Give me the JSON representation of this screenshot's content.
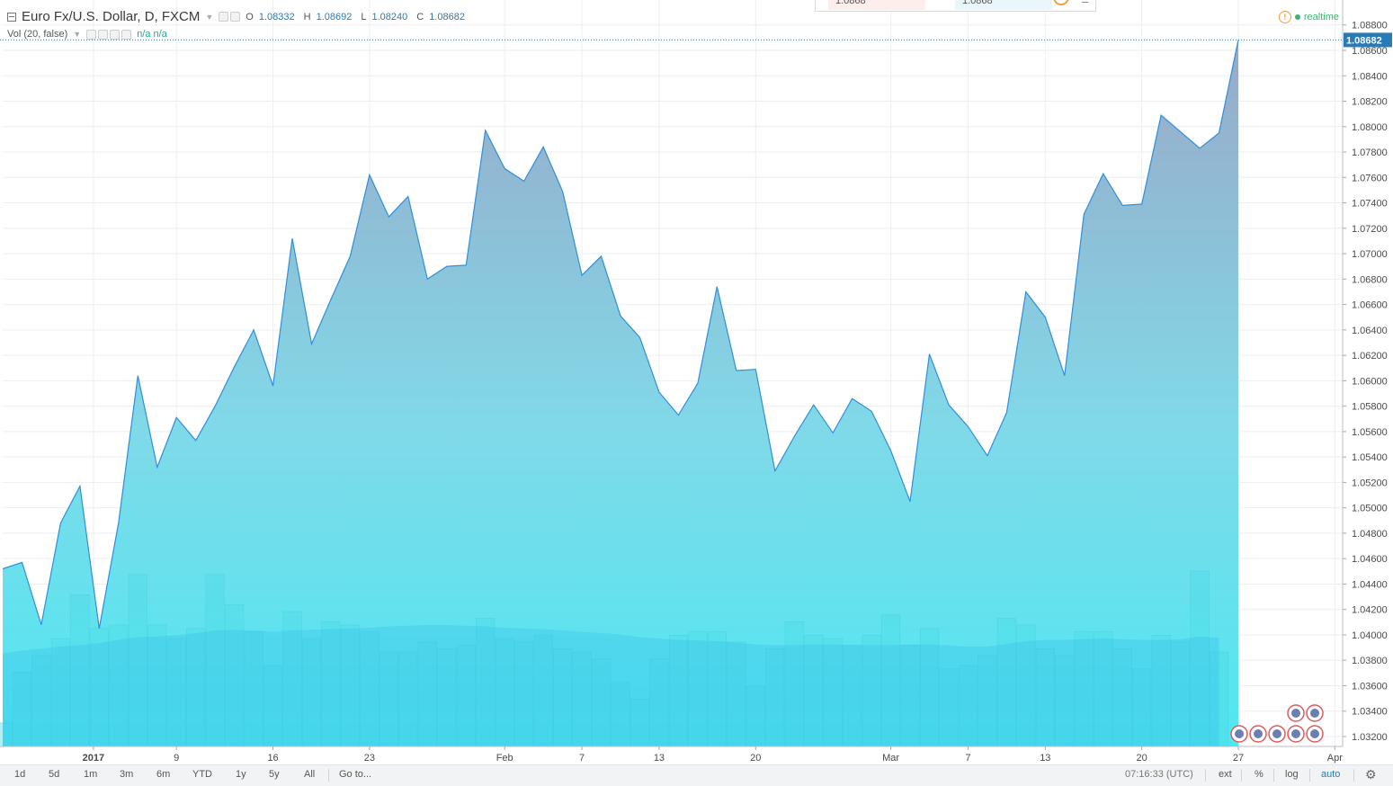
{
  "legend": {
    "symbol": "Euro Fx/U.S. Dollar, D, FXCM",
    "open_key": "O",
    "open": "1.08332",
    "high_key": "H",
    "high": "1.08692",
    "low_key": "L",
    "low": "1.08240",
    "close_key": "C",
    "close": "1.08682",
    "volume_label": "Vol (20, false)",
    "volume_values": "n/a n/a"
  },
  "status": {
    "realtime_label": "realtime"
  },
  "order_panel": {
    "sell_price": "1.0868",
    "buy_price": "1.0868"
  },
  "last_price_label": "1.08682",
  "timeframes": [
    "1d",
    "5d",
    "1m",
    "3m",
    "6m",
    "YTD",
    "1y",
    "5y",
    "All"
  ],
  "goto_label": "Go to...",
  "clock": "07:16:33 (UTC)",
  "scale_options": [
    "ext",
    "%",
    "log",
    "auto"
  ],
  "colors": {
    "line": "#2f8fd8",
    "area_top": "#9aa8c8",
    "area_bottom": "#4ee5f0",
    "volume": "#4ed9e3",
    "volume_ma": "#2fb7e8",
    "accent": "#2a7ab6"
  },
  "chart_data": {
    "type": "area",
    "series": [
      {
        "values": [
          1.0452,
          1.0457,
          1.0408,
          1.0488,
          1.0517,
          1.0405,
          1.0488,
          1.0604,
          1.0532,
          1.0571,
          1.0553,
          1.058,
          1.0611,
          1.064,
          1.0596,
          1.0712,
          1.0629,
          1.0664,
          1.0698,
          1.0762,
          1.0729,
          1.0745,
          1.068,
          1.069,
          1.0691,
          1.0797,
          1.0767,
          1.0757,
          1.0784,
          1.0749,
          1.0683,
          1.0698,
          1.0651,
          1.0634,
          1.0591,
          1.0573,
          1.0598,
          1.0674,
          1.0608,
          1.0609,
          1.0529,
          1.0556,
          1.0581,
          1.0559,
          1.0586,
          1.0576,
          1.0545,
          1.0505,
          1.0621,
          1.0581,
          1.0564,
          1.0541,
          1.0575,
          1.067,
          1.065,
          1.0604,
          1.0731,
          1.0763,
          1.0738,
          1.0739,
          1.0809,
          1.0796,
          1.0783,
          1.0795,
          1.08682
        ]
      }
    ],
    "volume": [
      0.35,
      1.1,
      1.35,
      1.6,
      2.25,
      1.75,
      1.8,
      2.55,
      1.8,
      1.6,
      1.75,
      2.55,
      2.1,
      1.7,
      1.2,
      2.0,
      1.6,
      1.85,
      1.8,
      1.7,
      1.4,
      1.4,
      1.55,
      1.45,
      1.5,
      1.9,
      1.6,
      1.55,
      1.65,
      1.45,
      1.4,
      1.3,
      0.95,
      0.7,
      1.3,
      1.65,
      1.7,
      1.7,
      1.55,
      0.9,
      1.45,
      1.85,
      1.65,
      1.6,
      1.5,
      1.65,
      1.95,
      1.5,
      1.75,
      1.15,
      1.2,
      1.35,
      1.9,
      1.8,
      1.45,
      1.35,
      1.7,
      1.7,
      1.45,
      1.15,
      1.65,
      1.55,
      2.6,
      1.4
    ],
    "volume_ma": [
      1.38,
      1.42,
      1.45,
      1.48,
      1.5,
      1.53,
      1.58,
      1.62,
      1.63,
      1.65,
      1.68,
      1.72,
      1.73,
      1.72,
      1.7,
      1.72,
      1.73,
      1.74,
      1.75,
      1.76,
      1.78,
      1.79,
      1.8,
      1.8,
      1.79,
      1.78,
      1.76,
      1.75,
      1.74,
      1.72,
      1.7,
      1.68,
      1.66,
      1.62,
      1.6,
      1.58,
      1.57,
      1.56,
      1.54,
      1.51,
      1.5,
      1.5,
      1.51,
      1.51,
      1.5,
      1.5,
      1.5,
      1.51,
      1.51,
      1.5,
      1.48,
      1.48,
      1.52,
      1.56,
      1.58,
      1.58,
      1.59,
      1.6,
      1.59,
      1.58,
      1.58,
      1.59,
      1.63,
      1.61
    ],
    "ylim": [
      1.0312,
      1.0888
    ],
    "y_ticks": [
      1.032,
      1.034,
      1.036,
      1.038,
      1.04,
      1.042,
      1.044,
      1.046,
      1.048,
      1.05,
      1.052,
      1.054,
      1.056,
      1.058,
      1.06,
      1.062,
      1.064,
      1.066,
      1.068,
      1.07,
      1.072,
      1.074,
      1.076,
      1.078,
      1.08,
      1.082,
      1.084,
      1.086,
      1.088
    ],
    "x_ticks": [
      {
        "label": "2017",
        "index": 4.7
      },
      {
        "label": "9",
        "index": 9
      },
      {
        "label": "16",
        "index": 14
      },
      {
        "label": "23",
        "index": 19
      },
      {
        "label": "Feb",
        "index": 26
      },
      {
        "label": "7",
        "index": 30
      },
      {
        "label": "13",
        "index": 34
      },
      {
        "label": "20",
        "index": 39
      },
      {
        "label": "Mar",
        "index": 46
      },
      {
        "label": "7",
        "index": 50
      },
      {
        "label": "13",
        "index": 54
      },
      {
        "label": "20",
        "index": 59
      },
      {
        "label": "27",
        "index": 64
      },
      {
        "label": "Apr",
        "index": 69
      }
    ],
    "grid": true
  }
}
